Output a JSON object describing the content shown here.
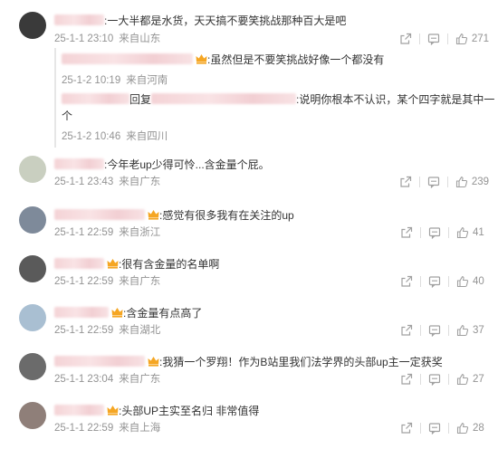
{
  "comments": [
    {
      "text": ":一大半都是水货，天天搞不要笑挑战那种百大是吧",
      "date": "25-1-1 23:10",
      "location": "来自山东",
      "likes": "271",
      "avatar_color": "#3a3a3a"
    },
    {
      "text": ":今年老up少得可怜...含金量个屁。",
      "date": "25-1-1 23:43",
      "location": "来自广东",
      "likes": "239",
      "avatar_color": "#c9cfc0"
    },
    {
      "text": ":感觉有很多我有在关注的up",
      "date": "25-1-1 22:59",
      "location": "来自浙江",
      "likes": "41",
      "avatar_color": "#7e8a9a"
    },
    {
      "text": ":很有含金量的名单啊",
      "date": "25-1-1 22:59",
      "location": "来自广东",
      "likes": "40",
      "avatar_color": "#5a5a5a"
    },
    {
      "text": ":含金量有点高了",
      "date": "25-1-1 22:59",
      "location": "来自湖北",
      "likes": "37",
      "avatar_color": "#a9bfd2"
    },
    {
      "text": ":我猜一个罗翔！作为B站里我们法学界的头部up主一定获奖",
      "date": "25-1-1 23:04",
      "location": "来自广东",
      "likes": "27",
      "avatar_color": "#6b6b6b"
    },
    {
      "text": ":头部UP主实至名归 非常值得",
      "date": "25-1-1 22:59",
      "location": "来自上海",
      "likes": "28",
      "avatar_color": "#8f7f79"
    }
  ],
  "replies": [
    {
      "text": ":虽然但是不要笑挑战好像一个都没有",
      "date": "25-1-2 10:19",
      "location": "来自河南"
    },
    {
      "reply_word": "回复",
      "text_line1": ":说明你根本不认识，某个四字就是其中一",
      "text_line2": "个",
      "date": "25-1-2 10:46",
      "location": "来自四川"
    }
  ],
  "icons": {
    "share": "share-icon",
    "comment": "comment-icon",
    "like": "thumbs-up-icon",
    "crown": "crown-badge-icon"
  },
  "colors": {
    "meta_text": "#939393",
    "crown": "#f5a623",
    "blurred_name": "#f4d3d6"
  }
}
